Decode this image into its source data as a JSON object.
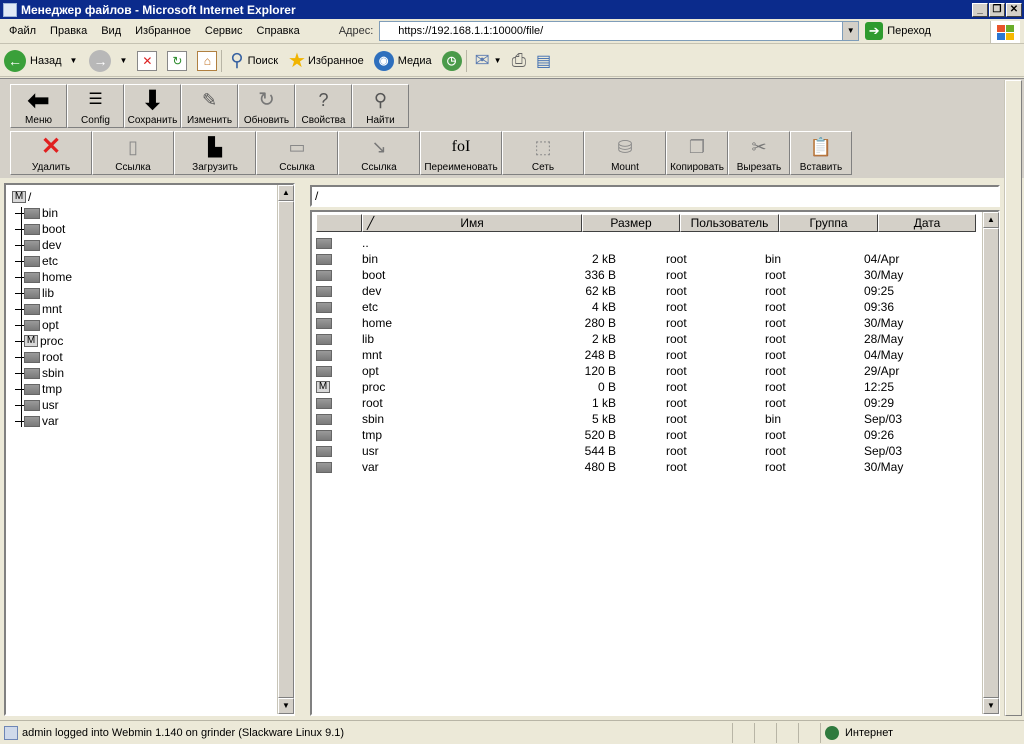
{
  "window": {
    "title": "Менеджер файлов - Microsoft Internet Explorer",
    "buttons": [
      "_",
      "❐",
      "✕"
    ]
  },
  "menu": [
    "Файл",
    "Правка",
    "Вид",
    "Избранное",
    "Сервис",
    "Справка"
  ],
  "address": {
    "label": "Адрес:",
    "url": "https://192.168.1.1:10000/file/",
    "go_label": "Переход"
  },
  "ie_toolbar": {
    "back": "Назад",
    "search": "Поиск",
    "favorites": "Избранное",
    "media": "Медиа"
  },
  "webmin_toolbar_1": [
    {
      "label": "Меню",
      "icon": "arrow-left-icon"
    },
    {
      "label": "Config",
      "icon": "config-icon"
    },
    {
      "label": "Сохранить",
      "icon": "arrow-down-icon"
    },
    {
      "label": "Изменить",
      "icon": "edit-icon"
    },
    {
      "label": "Обновить",
      "icon": "refresh-icon"
    },
    {
      "label": "Свойства",
      "icon": "properties-icon"
    },
    {
      "label": "Найти",
      "icon": "find-icon"
    }
  ],
  "webmin_toolbar_2": [
    {
      "label": "Удалить",
      "icon": "delete-icon"
    },
    {
      "label": "Ссылка",
      "icon": "new-file-icon"
    },
    {
      "label": "Загрузить",
      "icon": "upload-icon"
    },
    {
      "label": "Ссылка",
      "icon": "new-folder-icon"
    },
    {
      "label": "Ссылка",
      "icon": "link-icon"
    },
    {
      "label": "Переименовать",
      "icon": "rename-icon",
      "glyph": "foI"
    },
    {
      "label": "Сеть",
      "icon": "network-icon"
    },
    {
      "label": "Mount",
      "icon": "mount-icon"
    },
    {
      "label": "Копировать",
      "icon": "copy-icon"
    },
    {
      "label": "Вырезать",
      "icon": "cut-icon"
    },
    {
      "label": "Вставить",
      "icon": "paste-icon"
    }
  ],
  "tree": {
    "root_marker": "M",
    "root": "/",
    "items": [
      {
        "name": "bin",
        "marker": ""
      },
      {
        "name": "boot",
        "marker": ""
      },
      {
        "name": "dev",
        "marker": ""
      },
      {
        "name": "etc",
        "marker": ""
      },
      {
        "name": "home",
        "marker": ""
      },
      {
        "name": "lib",
        "marker": ""
      },
      {
        "name": "mnt",
        "marker": ""
      },
      {
        "name": "opt",
        "marker": ""
      },
      {
        "name": "proc",
        "marker": "M"
      },
      {
        "name": "root",
        "marker": ""
      },
      {
        "name": "sbin",
        "marker": ""
      },
      {
        "name": "tmp",
        "marker": ""
      },
      {
        "name": "usr",
        "marker": ""
      },
      {
        "name": "var",
        "marker": ""
      }
    ]
  },
  "current_path": "/",
  "files": {
    "sort_indicator": "╱",
    "headers": [
      "Имя",
      "Размер",
      "Пользователь",
      "Группа",
      "Дата"
    ],
    "parent": "..",
    "rows": [
      {
        "marker": "",
        "name": "bin",
        "size": "2 kB",
        "user": "root",
        "group": "bin",
        "date": "04/Apr"
      },
      {
        "marker": "",
        "name": "boot",
        "size": "336 B",
        "user": "root",
        "group": "root",
        "date": "30/May"
      },
      {
        "marker": "",
        "name": "dev",
        "size": "62 kB",
        "user": "root",
        "group": "root",
        "date": "09:25"
      },
      {
        "marker": "",
        "name": "etc",
        "size": "4 kB",
        "user": "root",
        "group": "root",
        "date": "09:36"
      },
      {
        "marker": "",
        "name": "home",
        "size": "280 B",
        "user": "root",
        "group": "root",
        "date": "30/May"
      },
      {
        "marker": "",
        "name": "lib",
        "size": "2 kB",
        "user": "root",
        "group": "root",
        "date": "28/May"
      },
      {
        "marker": "",
        "name": "mnt",
        "size": "248 B",
        "user": "root",
        "group": "root",
        "date": "04/May"
      },
      {
        "marker": "",
        "name": "opt",
        "size": "120 B",
        "user": "root",
        "group": "root",
        "date": "29/Apr"
      },
      {
        "marker": "M",
        "name": "proc",
        "size": "0 B",
        "user": "root",
        "group": "root",
        "date": "12:25"
      },
      {
        "marker": "",
        "name": "root",
        "size": "1 kB",
        "user": "root",
        "group": "root",
        "date": "09:29"
      },
      {
        "marker": "",
        "name": "sbin",
        "size": "5 kB",
        "user": "root",
        "group": "bin",
        "date": "Sep/03"
      },
      {
        "marker": "",
        "name": "tmp",
        "size": "520 B",
        "user": "root",
        "group": "root",
        "date": "09:26"
      },
      {
        "marker": "",
        "name": "usr",
        "size": "544 B",
        "user": "root",
        "group": "root",
        "date": "Sep/03"
      },
      {
        "marker": "",
        "name": "var",
        "size": "480 B",
        "user": "root",
        "group": "root",
        "date": "30/May"
      }
    ]
  },
  "status": {
    "text": "admin logged into Webmin 1.140 on grinder (Slackware Linux 9.1)",
    "zone": "Интернет"
  }
}
